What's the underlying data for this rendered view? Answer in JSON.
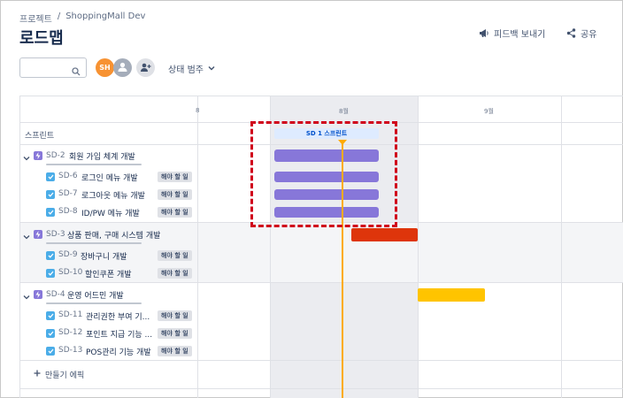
{
  "breadcrumb": {
    "project": "프로젝트",
    "separator": "/",
    "name": "ShoppingMall Dev"
  },
  "page": {
    "title": "로드맵"
  },
  "header": {
    "feedback_label": "피드백 보내기",
    "share_label": "공유"
  },
  "toolbar": {
    "search": {
      "value": "",
      "placeholder": ""
    },
    "avatar_initials": "SH",
    "status_filter_label": "상태 범주"
  },
  "timeline": {
    "months": [
      "8월",
      "9월"
    ],
    "left_month_partial": "8"
  },
  "sprint": {
    "label": "스프린트",
    "tag": "SD 1 스프린트"
  },
  "epics": [
    {
      "key": "SD-2",
      "title": "회원 가입 체계 개발",
      "icon": "epic-icon",
      "bar_color": "#8777d9",
      "tasks": [
        {
          "key": "SD-6",
          "title": "로그인 메뉴 개발",
          "status": "해야 할 일"
        },
        {
          "key": "SD-7",
          "title": "로그아웃 메뉴 개발",
          "status": "해야 할 일"
        },
        {
          "key": "SD-8",
          "title": "ID/PW 메뉴 개발",
          "status": "해야 할 일"
        }
      ]
    },
    {
      "key": "SD-3",
      "title": "상품 판매, 구매 시스템 개발",
      "icon": "epic-icon",
      "bar_color": "#de350b",
      "tasks": [
        {
          "key": "SD-9",
          "title": "장바구니 개발",
          "status": "해야 할 일"
        },
        {
          "key": "SD-10",
          "title": "할인쿠폰 개발",
          "status": "해야 할 일"
        }
      ]
    },
    {
      "key": "SD-4",
      "title": "운영 어드민 개발",
      "icon": "epic-icon",
      "bar_color": "#ffc400",
      "tasks": [
        {
          "key": "SD-11",
          "title": "관리권한 부여 기...",
          "status": "해야 할 일"
        },
        {
          "key": "SD-12",
          "title": "포인트 지급 기능 ...",
          "status": "해야 할 일"
        },
        {
          "key": "SD-13",
          "title": "POS관리 기능 개발",
          "status": "해야 할 일"
        }
      ]
    }
  ],
  "create_epic_label": "만들기 에픽",
  "colors": {
    "accent": "#0052cc",
    "today_line": "#ffab00",
    "highlight": "#d0021b",
    "epic_bar": "#8777d9"
  }
}
